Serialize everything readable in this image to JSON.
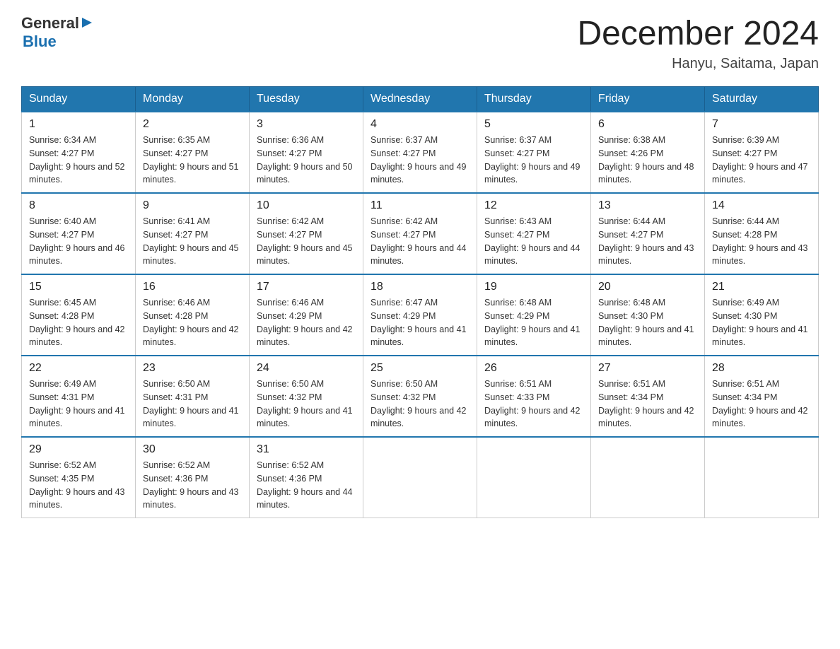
{
  "header": {
    "logo_general": "General",
    "logo_blue": "Blue",
    "title": "December 2024",
    "location": "Hanyu, Saitama, Japan"
  },
  "days_of_week": [
    "Sunday",
    "Monday",
    "Tuesday",
    "Wednesday",
    "Thursday",
    "Friday",
    "Saturday"
  ],
  "weeks": [
    [
      {
        "day": "1",
        "sunrise": "6:34 AM",
        "sunset": "4:27 PM",
        "daylight": "9 hours and 52 minutes."
      },
      {
        "day": "2",
        "sunrise": "6:35 AM",
        "sunset": "4:27 PM",
        "daylight": "9 hours and 51 minutes."
      },
      {
        "day": "3",
        "sunrise": "6:36 AM",
        "sunset": "4:27 PM",
        "daylight": "9 hours and 50 minutes."
      },
      {
        "day": "4",
        "sunrise": "6:37 AM",
        "sunset": "4:27 PM",
        "daylight": "9 hours and 49 minutes."
      },
      {
        "day": "5",
        "sunrise": "6:37 AM",
        "sunset": "4:27 PM",
        "daylight": "9 hours and 49 minutes."
      },
      {
        "day": "6",
        "sunrise": "6:38 AM",
        "sunset": "4:26 PM",
        "daylight": "9 hours and 48 minutes."
      },
      {
        "day": "7",
        "sunrise": "6:39 AM",
        "sunset": "4:27 PM",
        "daylight": "9 hours and 47 minutes."
      }
    ],
    [
      {
        "day": "8",
        "sunrise": "6:40 AM",
        "sunset": "4:27 PM",
        "daylight": "9 hours and 46 minutes."
      },
      {
        "day": "9",
        "sunrise": "6:41 AM",
        "sunset": "4:27 PM",
        "daylight": "9 hours and 45 minutes."
      },
      {
        "day": "10",
        "sunrise": "6:42 AM",
        "sunset": "4:27 PM",
        "daylight": "9 hours and 45 minutes."
      },
      {
        "day": "11",
        "sunrise": "6:42 AM",
        "sunset": "4:27 PM",
        "daylight": "9 hours and 44 minutes."
      },
      {
        "day": "12",
        "sunrise": "6:43 AM",
        "sunset": "4:27 PM",
        "daylight": "9 hours and 44 minutes."
      },
      {
        "day": "13",
        "sunrise": "6:44 AM",
        "sunset": "4:27 PM",
        "daylight": "9 hours and 43 minutes."
      },
      {
        "day": "14",
        "sunrise": "6:44 AM",
        "sunset": "4:28 PM",
        "daylight": "9 hours and 43 minutes."
      }
    ],
    [
      {
        "day": "15",
        "sunrise": "6:45 AM",
        "sunset": "4:28 PM",
        "daylight": "9 hours and 42 minutes."
      },
      {
        "day": "16",
        "sunrise": "6:46 AM",
        "sunset": "4:28 PM",
        "daylight": "9 hours and 42 minutes."
      },
      {
        "day": "17",
        "sunrise": "6:46 AM",
        "sunset": "4:29 PM",
        "daylight": "9 hours and 42 minutes."
      },
      {
        "day": "18",
        "sunrise": "6:47 AM",
        "sunset": "4:29 PM",
        "daylight": "9 hours and 41 minutes."
      },
      {
        "day": "19",
        "sunrise": "6:48 AM",
        "sunset": "4:29 PM",
        "daylight": "9 hours and 41 minutes."
      },
      {
        "day": "20",
        "sunrise": "6:48 AM",
        "sunset": "4:30 PM",
        "daylight": "9 hours and 41 minutes."
      },
      {
        "day": "21",
        "sunrise": "6:49 AM",
        "sunset": "4:30 PM",
        "daylight": "9 hours and 41 minutes."
      }
    ],
    [
      {
        "day": "22",
        "sunrise": "6:49 AM",
        "sunset": "4:31 PM",
        "daylight": "9 hours and 41 minutes."
      },
      {
        "day": "23",
        "sunrise": "6:50 AM",
        "sunset": "4:31 PM",
        "daylight": "9 hours and 41 minutes."
      },
      {
        "day": "24",
        "sunrise": "6:50 AM",
        "sunset": "4:32 PM",
        "daylight": "9 hours and 41 minutes."
      },
      {
        "day": "25",
        "sunrise": "6:50 AM",
        "sunset": "4:32 PM",
        "daylight": "9 hours and 42 minutes."
      },
      {
        "day": "26",
        "sunrise": "6:51 AM",
        "sunset": "4:33 PM",
        "daylight": "9 hours and 42 minutes."
      },
      {
        "day": "27",
        "sunrise": "6:51 AM",
        "sunset": "4:34 PM",
        "daylight": "9 hours and 42 minutes."
      },
      {
        "day": "28",
        "sunrise": "6:51 AM",
        "sunset": "4:34 PM",
        "daylight": "9 hours and 42 minutes."
      }
    ],
    [
      {
        "day": "29",
        "sunrise": "6:52 AM",
        "sunset": "4:35 PM",
        "daylight": "9 hours and 43 minutes."
      },
      {
        "day": "30",
        "sunrise": "6:52 AM",
        "sunset": "4:36 PM",
        "daylight": "9 hours and 43 minutes."
      },
      {
        "day": "31",
        "sunrise": "6:52 AM",
        "sunset": "4:36 PM",
        "daylight": "9 hours and 44 minutes."
      },
      null,
      null,
      null,
      null
    ]
  ]
}
